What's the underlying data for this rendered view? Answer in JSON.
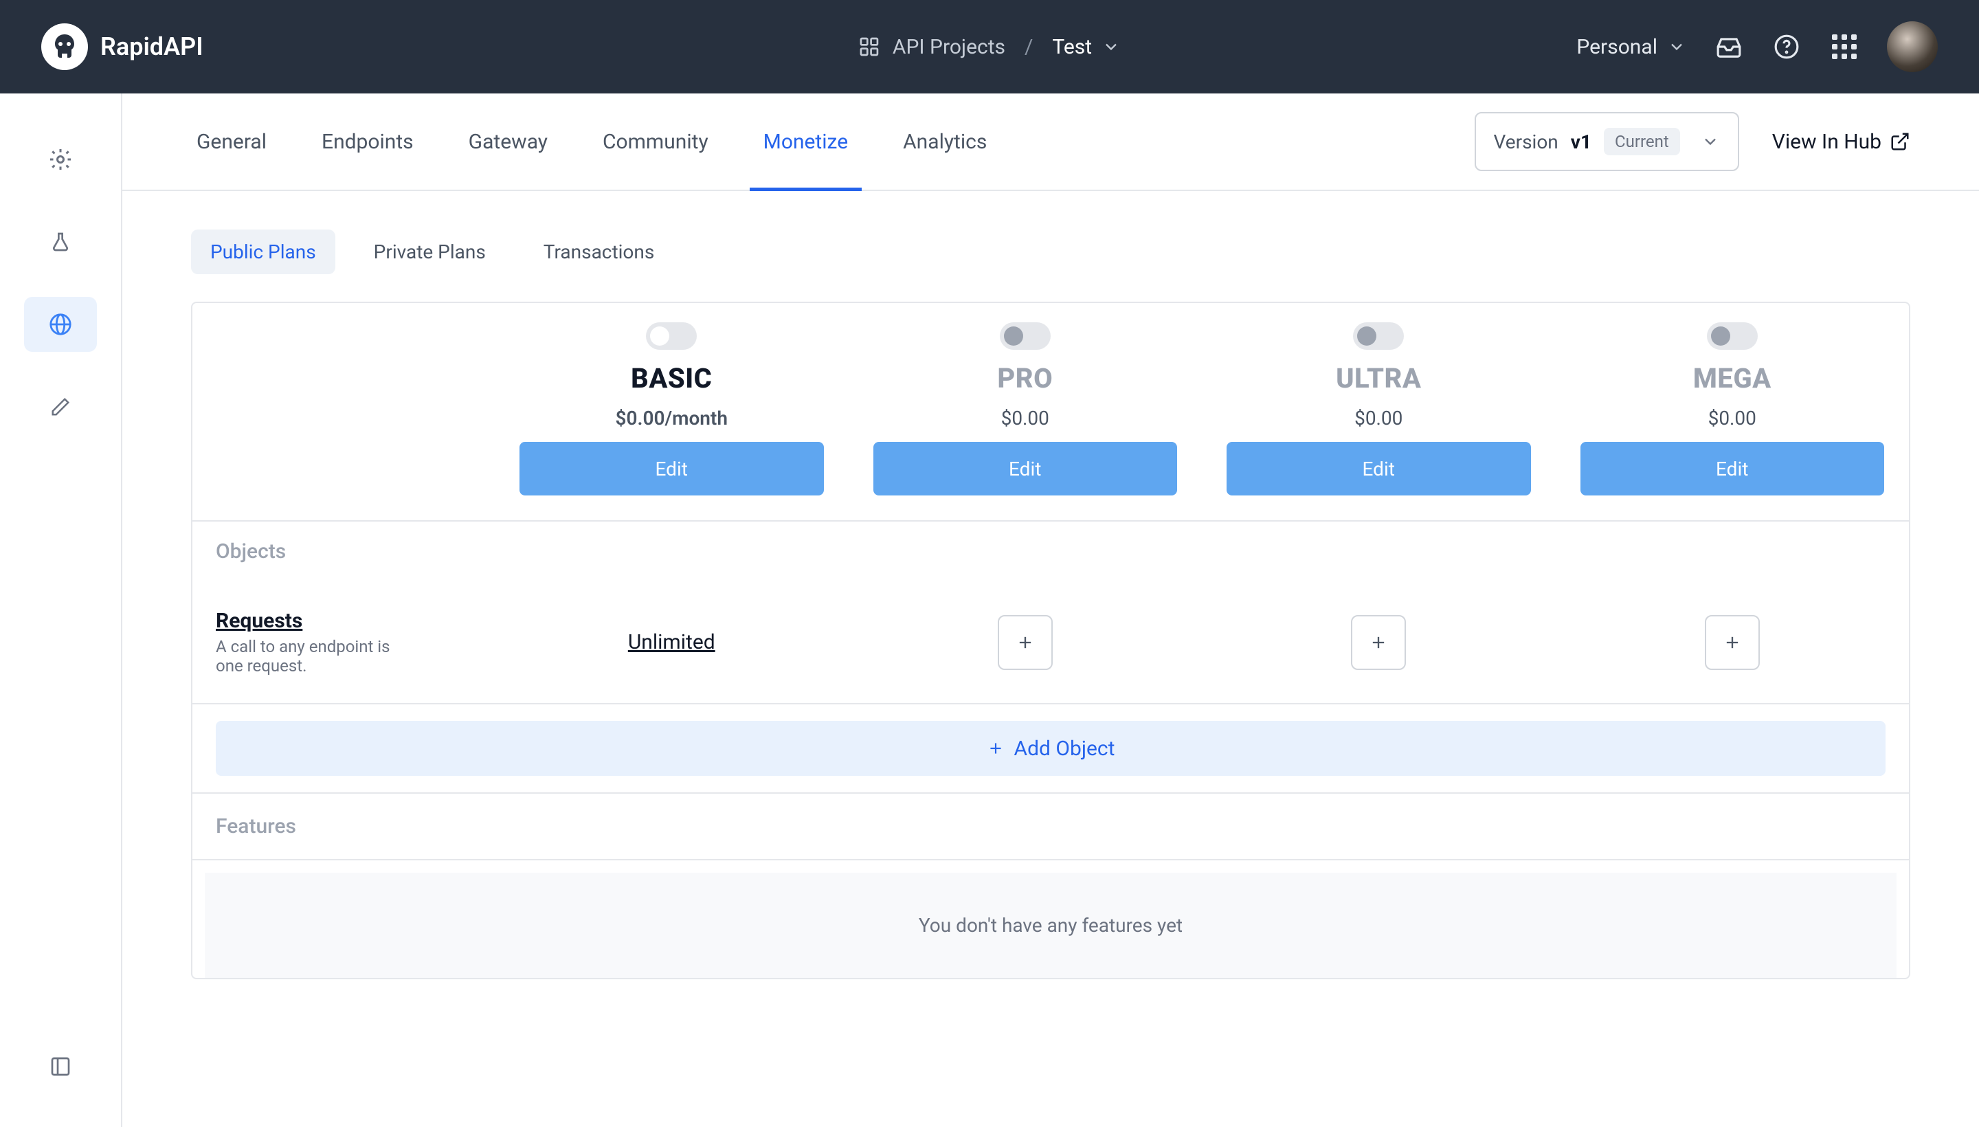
{
  "brand": "RapidAPI",
  "breadcrumb": {
    "root": "API Projects",
    "sep": "/",
    "current": "Test"
  },
  "topbar": {
    "workspace": "Personal"
  },
  "nav_tabs": [
    "General",
    "Endpoints",
    "Gateway",
    "Community",
    "Monetize",
    "Analytics"
  ],
  "nav_active": "Monetize",
  "version": {
    "label": "Version",
    "name": "v1",
    "badge": "Current"
  },
  "view_hub": "View In Hub",
  "sub_tabs": [
    "Public Plans",
    "Private Plans",
    "Transactions"
  ],
  "sub_active": "Public Plans",
  "plans": [
    {
      "name": "BASIC",
      "price": "$0.00/month",
      "enabled": true,
      "edit": "Edit"
    },
    {
      "name": "PRO",
      "price": "$0.00",
      "enabled": false,
      "edit": "Edit"
    },
    {
      "name": "ULTRA",
      "price": "$0.00",
      "enabled": false,
      "edit": "Edit"
    },
    {
      "name": "MEGA",
      "price": "$0.00",
      "enabled": false,
      "edit": "Edit"
    }
  ],
  "sections": {
    "objects_label": "Objects",
    "features_label": "Features"
  },
  "object_row": {
    "title": "Requests",
    "desc": "A call to any endpoint is one request.",
    "basic_value": "Unlimited"
  },
  "add_object": "Add Object",
  "features_empty": "You don't have any features yet"
}
